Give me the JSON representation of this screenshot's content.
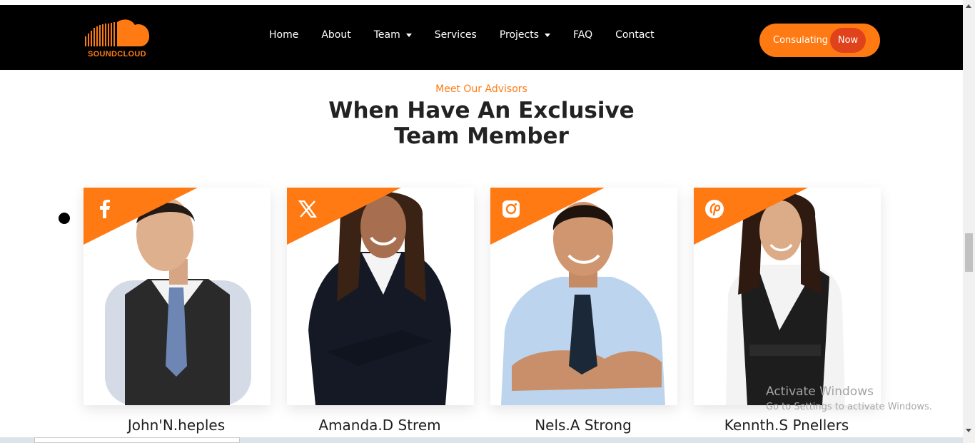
{
  "brand": {
    "name": "SOUNDCLOUD",
    "color": "#ff7a12"
  },
  "nav": {
    "items": [
      {
        "label": "Home",
        "dropdown": false
      },
      {
        "label": "About",
        "dropdown": false
      },
      {
        "label": "Team",
        "dropdown": true
      },
      {
        "label": "Services",
        "dropdown": false
      },
      {
        "label": "Projects",
        "dropdown": true
      },
      {
        "label": "FAQ",
        "dropdown": false
      },
      {
        "label": "Contact",
        "dropdown": false
      }
    ],
    "cta": {
      "label": "Consulating",
      "highlight": "Now"
    }
  },
  "section": {
    "subtitle": "Meet Our Advisors",
    "title_line1": "When Have An Exclusive",
    "title_line2": "Team Member"
  },
  "team": [
    {
      "name": "John'N.heples",
      "social_icon": "facebook-icon"
    },
    {
      "name": "Amanda.D Strem",
      "social_icon": "x-icon"
    },
    {
      "name": "Nels.A Strong",
      "social_icon": "instagram-icon"
    },
    {
      "name": "Kennth.S Pnellers",
      "social_icon": "pinterest-icon"
    }
  ],
  "watermark": {
    "line1": "Activate Windows",
    "line2": "Go to Settings to activate Windows."
  },
  "colors": {
    "accent": "#ff7a12",
    "accent_dark": "#e0431c",
    "header_bg": "#000000"
  }
}
